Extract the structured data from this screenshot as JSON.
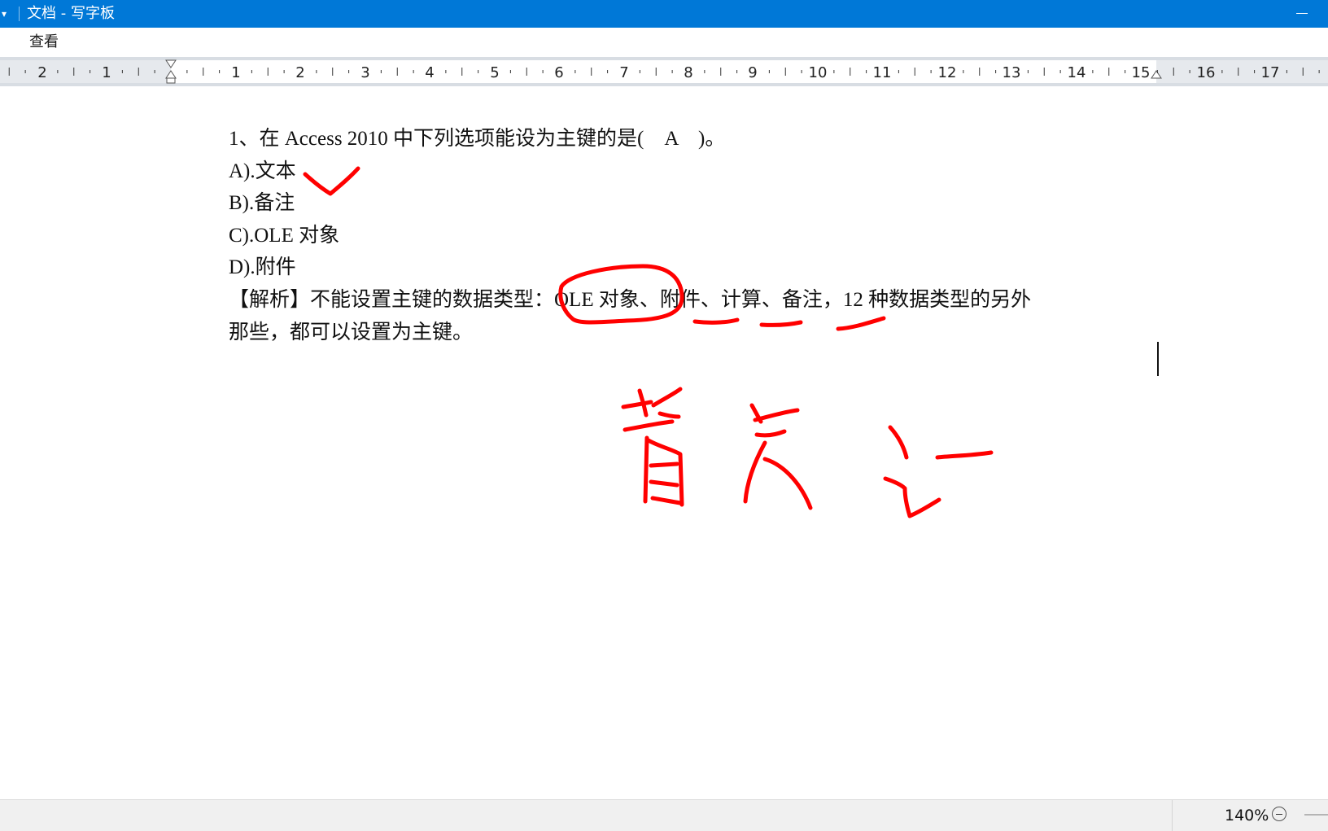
{
  "window": {
    "title": "文档 - 写字板",
    "quick_access_glyph": "▾"
  },
  "menu": {
    "view_label": "查看"
  },
  "ruler": {
    "left_labels": [
      "2",
      "1"
    ],
    "right_labels": [
      "1",
      "2",
      "3",
      "4",
      "5",
      "6",
      "7",
      "8",
      "9",
      "10",
      "11",
      "12",
      "13",
      "14",
      "15",
      "16",
      "17"
    ]
  },
  "document": {
    "lines": [
      "1、在 Access 2010 中下列选项能设为主键的是(　A　)。",
      "A).文本",
      "B).备注",
      "C).OLE 对象",
      "D).附件",
      "【解析】不能设置主键的数据类型：OLE 对象、附件、计算、备注，12 种数据类型的另外",
      "那些，都可以设置为主键。"
    ]
  },
  "annotations": {
    "ink_color": "#ff0000",
    "marks": [
      "checkmark",
      "circle",
      "underline",
      "underline",
      "underline",
      "handwriting"
    ]
  },
  "status": {
    "zoom": "140%"
  }
}
